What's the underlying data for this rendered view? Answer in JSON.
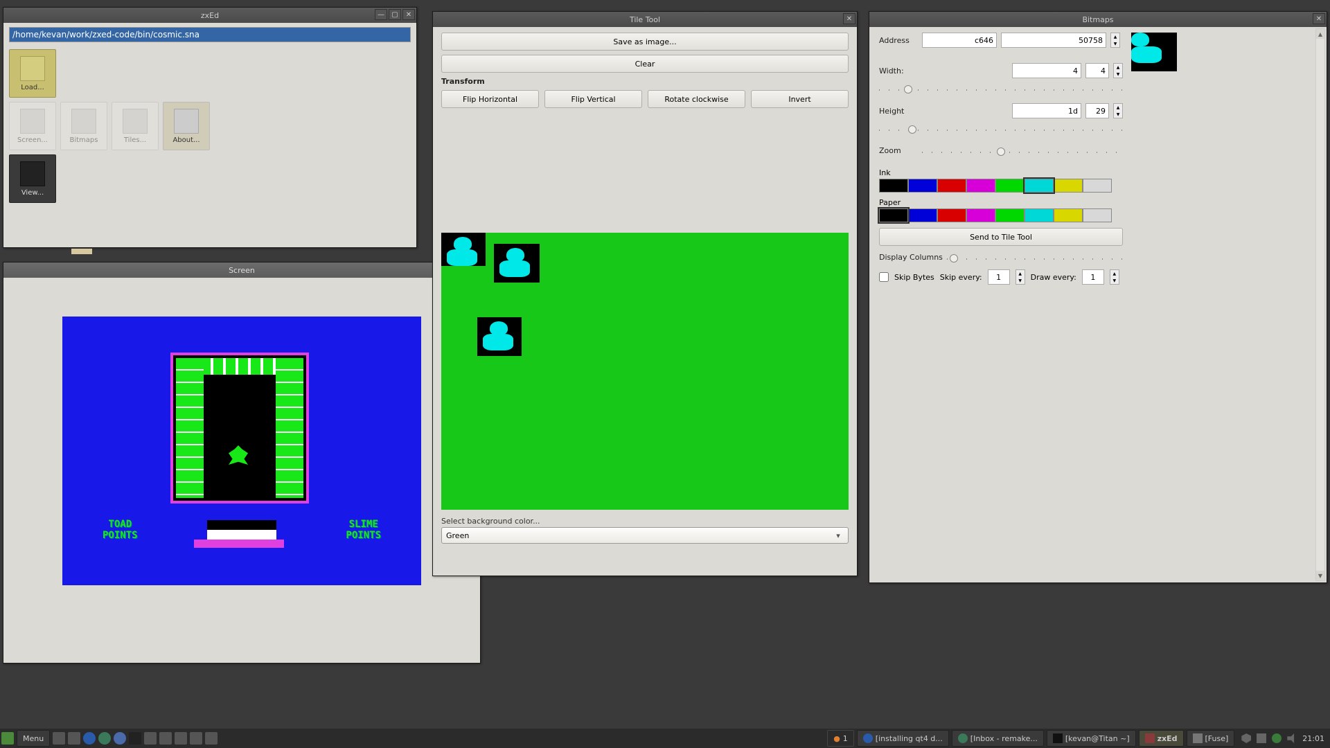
{
  "zxed": {
    "title": "zxEd",
    "path": "/home/kevan/work/zxed-code/bin/cosmic.sna",
    "tools": {
      "load": "Load...",
      "screen": "Screen...",
      "bitmaps": "Bitmaps",
      "tiles": "Tiles...",
      "about": "About...",
      "view": "View..."
    }
  },
  "screen": {
    "title": "Screen",
    "toad_points": "TOAD\nPOINTS",
    "slime_points": "SLIME\nPOINTS"
  },
  "tiletool": {
    "title": "Tile Tool",
    "save_image": "Save as image...",
    "clear": "Clear",
    "transform": "Transform",
    "flip_h": "Flip Horizontal",
    "flip_v": "Flip Vertical",
    "rotate": "Rotate clockwise",
    "invert": "Invert",
    "bg_label": "Select background color...",
    "bg_value": "Green"
  },
  "bitmaps": {
    "title": "Bitmaps",
    "address_label": "Address",
    "address_hex": "c646",
    "address_dec": "50758",
    "width_label": "Width:",
    "width_hex": "4",
    "width_dec": "4",
    "height_label": "Height",
    "height_hex": "1d",
    "height_dec": "29",
    "zoom_label": "Zoom",
    "ink_label": "Ink",
    "paper_label": "Paper",
    "send": "Send to Tile Tool",
    "display_cols_label": "Display Columns",
    "skip_bytes_label": "Skip Bytes",
    "skip_every_label": "Skip every:",
    "skip_every_val": "1",
    "draw_every_label": "Draw every:",
    "draw_every_val": "1",
    "palette": [
      "#000000",
      "#0000d8",
      "#d80000",
      "#d800d8",
      "#00d800",
      "#00d8d8",
      "#d8d800",
      "#d8d8d8"
    ]
  },
  "taskbar": {
    "menu": "Menu",
    "workspace": "1",
    "tasks": [
      {
        "label": "[installing qt4 d...",
        "active": false
      },
      {
        "label": "[Inbox - remake...",
        "active": false
      },
      {
        "label": "[kevan@Titan ~]",
        "active": false
      },
      {
        "label": "zxEd",
        "active": true
      },
      {
        "label": "[Fuse]",
        "active": false
      }
    ],
    "clock": "21:01"
  }
}
